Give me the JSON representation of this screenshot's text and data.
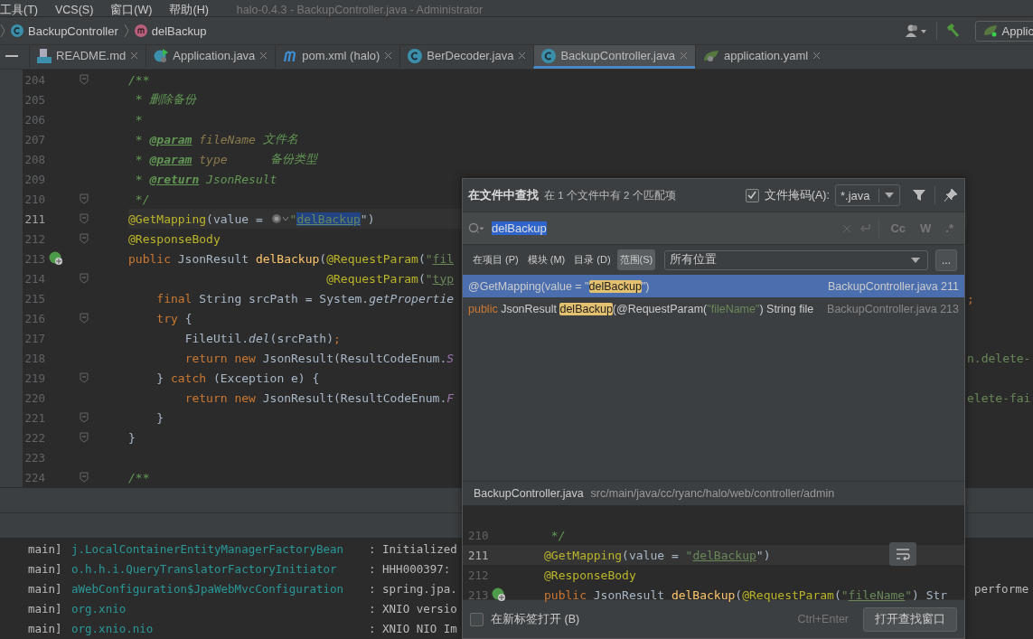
{
  "menu": [
    {
      "label": "工具(T)"
    },
    {
      "label": "VCS(S)"
    },
    {
      "label": "窗口(W)"
    },
    {
      "label": "帮助(H)"
    }
  ],
  "window": {
    "title": "halo-0.4.3 - BackupController.java - Administrator"
  },
  "breadcrumbs": [
    {
      "label": "BackupController",
      "kind": "class"
    },
    {
      "label": "delBackup",
      "kind": "method"
    }
  ],
  "toolbar": {
    "run_config": "Applic"
  },
  "tabs": [
    {
      "label": "README.md",
      "kind": "markdown",
      "selected": false
    },
    {
      "label": "Application.java",
      "kind": "runnable",
      "selected": false
    },
    {
      "label": "pom.xml (halo)",
      "kind": "maven",
      "selected": false
    },
    {
      "label": "BerDecoder.java",
      "kind": "class",
      "selected": false
    },
    {
      "label": "BackupController.java",
      "kind": "class",
      "selected": true
    },
    {
      "label": "application.yaml",
      "kind": "spring",
      "selected": false
    }
  ],
  "editor": {
    "lines": [
      {
        "number": "204",
        "kind": "code",
        "current": false,
        "fold": true,
        "segments": [
          {
            "text": "/**",
            "kind": "comment"
          }
        ]
      },
      {
        "number": "205",
        "kind": "code",
        "current": false,
        "fold": false,
        "segments": [
          {
            "text": " * 删除备份",
            "kind": "comment"
          }
        ]
      },
      {
        "number": "206",
        "kind": "code",
        "current": false,
        "fold": false,
        "segments": [
          {
            "text": " *",
            "kind": "comment"
          }
        ]
      },
      {
        "number": "207",
        "kind": "code",
        "current": false,
        "fold": false,
        "segments": [
          {
            "text": " * ",
            "kind": "comment"
          },
          {
            "text": "@param",
            "kind": "doc_tag"
          },
          {
            "text": " fileName",
            "kind": "doc_param"
          },
          {
            "text": " 文件名",
            "kind": "comment"
          }
        ]
      },
      {
        "number": "208",
        "kind": "code",
        "current": false,
        "fold": false,
        "segments": [
          {
            "text": " * ",
            "kind": "comment"
          },
          {
            "text": "@param",
            "kind": "doc_tag"
          },
          {
            "text": " type",
            "kind": "doc_param"
          },
          {
            "text": "      备份类型",
            "kind": "comment"
          }
        ]
      },
      {
        "number": "209",
        "kind": "code",
        "current": false,
        "fold": false,
        "segments": [
          {
            "text": " * ",
            "kind": "comment"
          },
          {
            "text": "@return",
            "kind": "doc_tag"
          },
          {
            "text": " JsonResult",
            "kind": "comment"
          }
        ]
      },
      {
        "number": "210",
        "kind": "code",
        "current": false,
        "fold": true,
        "segments": [
          {
            "text": " */",
            "kind": "comment"
          }
        ]
      },
      {
        "number": "211",
        "kind": "code",
        "current": true,
        "fold": true,
        "segments": [
          {
            "text": "@GetMapping",
            "kind": "annotation"
          },
          {
            "text": "(value = ",
            "kind": "plain"
          },
          {
            "kind": "inlay"
          },
          {
            "text": "\"",
            "kind": "string"
          },
          {
            "text": "delBackup",
            "kind": "selected_string"
          },
          {
            "text": "\")",
            "kind": "plain"
          }
        ]
      },
      {
        "number": "212",
        "kind": "code",
        "current": false,
        "fold": true,
        "segments": [
          {
            "text": "@ResponseBody",
            "kind": "annotation"
          }
        ]
      },
      {
        "number": "213",
        "kind": "endpoint",
        "current": false,
        "fold": false,
        "segments": [
          {
            "text": "public",
            "kind": "keyword"
          },
          {
            "text": " JsonResult ",
            "kind": "plain"
          },
          {
            "text": "delBackup",
            "kind": "method"
          },
          {
            "text": "(",
            "kind": "plain"
          },
          {
            "text": "@RequestParam",
            "kind": "annotation"
          },
          {
            "text": "(",
            "kind": "plain"
          },
          {
            "text": "\"",
            "kind": "string"
          },
          {
            "text": "fil",
            "kind": "string_ref"
          }
        ]
      },
      {
        "number": "214",
        "kind": "code",
        "current": false,
        "fold": true,
        "segments": [
          {
            "text": "                            @RequestParam",
            "kind": "annotation"
          },
          {
            "text": "(",
            "kind": "plain"
          },
          {
            "text": "\"",
            "kind": "string"
          },
          {
            "text": "typ",
            "kind": "string_ref"
          }
        ]
      },
      {
        "number": "215",
        "kind": "code",
        "current": false,
        "fold": false,
        "segments": [
          {
            "text": "    final",
            "kind": "keyword"
          },
          {
            "text": " String srcPath = System.",
            "kind": "plain"
          },
          {
            "text": "getPropertie",
            "kind": "static"
          }
        ],
        "right": [
          {
            "text": ";",
            "kind": "keyword"
          }
        ]
      },
      {
        "number": "216",
        "kind": "code",
        "current": false,
        "fold": true,
        "segments": [
          {
            "text": "    try",
            "kind": "keyword"
          },
          {
            "text": " {",
            "kind": "plain"
          }
        ]
      },
      {
        "number": "217",
        "kind": "code",
        "current": false,
        "fold": false,
        "segments": [
          {
            "text": "        FileUtil.",
            "kind": "plain"
          },
          {
            "text": "del",
            "kind": "static"
          },
          {
            "text": "(srcPath)",
            "kind": "plain"
          },
          {
            "text": ";",
            "kind": "keyword"
          }
        ]
      },
      {
        "number": "218",
        "kind": "code",
        "current": false,
        "fold": false,
        "segments": [
          {
            "text": "        return new",
            "kind": "keyword"
          },
          {
            "text": " JsonResult(ResultCodeEnum.",
            "kind": "plain"
          },
          {
            "text": "S",
            "kind": "constant"
          }
        ],
        "right": [
          {
            "text": "n.delete-",
            "kind": "string"
          }
        ]
      },
      {
        "number": "219",
        "kind": "code",
        "current": false,
        "fold": true,
        "segments": [
          {
            "text": "    } ",
            "kind": "plain"
          },
          {
            "text": "catch",
            "kind": "keyword"
          },
          {
            "text": " (Exception e) {",
            "kind": "plain"
          }
        ]
      },
      {
        "number": "220",
        "kind": "code",
        "current": false,
        "fold": false,
        "segments": [
          {
            "text": "        return new",
            "kind": "keyword"
          },
          {
            "text": " JsonResult(ResultCodeEnum.",
            "kind": "plain"
          },
          {
            "text": "F",
            "kind": "constant"
          }
        ],
        "right": [
          {
            "text": "elete-fai",
            "kind": "string"
          }
        ]
      },
      {
        "number": "221",
        "kind": "code",
        "current": false,
        "fold": true,
        "segments": [
          {
            "text": "    }",
            "kind": "plain"
          }
        ]
      },
      {
        "number": "222",
        "kind": "code",
        "current": false,
        "fold": true,
        "segments": [
          {
            "text": "}",
            "kind": "plain"
          }
        ]
      },
      {
        "number": "223",
        "kind": "code",
        "current": false,
        "fold": false
      },
      {
        "number": "224",
        "kind": "code",
        "current": false,
        "fold": true,
        "segments": [
          {
            "text": "/**",
            "kind": "comment"
          }
        ]
      }
    ]
  },
  "find_popup": {
    "title": "在文件中查找",
    "summary": "在 1 个文件中有 2 个匹配项",
    "file_mask": {
      "checked": true,
      "label": "文件掩码(A):",
      "value": "*.java"
    },
    "search": {
      "value": "delBackup"
    },
    "options": [
      "Cc",
      "W",
      ".*"
    ],
    "scopes": [
      {
        "label": "在项目 (P)",
        "selected": false
      },
      {
        "label": "模块 (M)",
        "selected": false
      },
      {
        "label": "目录 (D)",
        "selected": false
      },
      {
        "label": "范围(S)",
        "selected": true
      }
    ],
    "scope_value": "所有位置",
    "more_button": "...",
    "results": [
      {
        "selected": true,
        "segments": [
          {
            "text": "@GetMapping(value = \"",
            "kind": "plain"
          },
          {
            "text": "delBackup",
            "kind": "match"
          },
          {
            "text": "\")",
            "kind": "plain"
          }
        ],
        "file": "BackupController.java 211"
      },
      {
        "selected": false,
        "segments": [
          {
            "text": "public",
            "kind": "keyword"
          },
          {
            "text": " JsonResult ",
            "kind": "plain"
          },
          {
            "text": "delBackup",
            "kind": "match"
          },
          {
            "text": "(@RequestParam(",
            "kind": "plain"
          },
          {
            "text": "\"fileName\"",
            "kind": "string"
          },
          {
            "text": ") String file",
            "kind": "plain"
          }
        ],
        "file": "BackupController.java 213"
      }
    ],
    "preview_file": "BackupController.java",
    "preview_path": "src/main/java/cc/ryanc/halo/web/controller/admin",
    "preview_lines": [
      {
        "number": "210",
        "kind": "code",
        "current": false,
        "segments": [
          {
            "text": " */",
            "kind": "comment"
          }
        ]
      },
      {
        "number": "211",
        "kind": "code",
        "current": true,
        "segments": [
          {
            "text": "@GetMapping",
            "kind": "annotation"
          },
          {
            "text": "(value = ",
            "kind": "plain"
          },
          {
            "text": "\"",
            "kind": "string"
          },
          {
            "text": "delBackup",
            "kind": "string_ref"
          },
          {
            "text": "\")",
            "kind": "plain"
          }
        ]
      },
      {
        "number": "212",
        "kind": "code",
        "current": false,
        "segments": [
          {
            "text": "@ResponseBody",
            "kind": "annotation"
          }
        ]
      },
      {
        "number": "213",
        "kind": "endpoint",
        "current": false,
        "segments": [
          {
            "text": "public",
            "kind": "keyword"
          },
          {
            "text": " JsonResult ",
            "kind": "plain"
          },
          {
            "text": "delBackup",
            "kind": "method"
          },
          {
            "text": "(",
            "kind": "plain"
          },
          {
            "text": "@RequestParam",
            "kind": "annotation"
          },
          {
            "text": "(",
            "kind": "plain"
          },
          {
            "text": "\"",
            "kind": "string"
          },
          {
            "text": "fileName",
            "kind": "string_ref"
          },
          {
            "text": "\"",
            "kind": "string"
          },
          {
            "text": ") Str",
            "kind": "plain"
          }
        ]
      }
    ],
    "new_tab": {
      "checked": false,
      "label": "在新标签打开 (B)"
    },
    "shortcut": "Ctrl+Enter",
    "open_button": "打开查找窗口"
  },
  "console": {
    "rows": [
      {
        "thread": "main]",
        "logger": "j.LocalContainerEntityManagerFactoryBean",
        "message": ": Initialized"
      },
      {
        "thread": "main]",
        "logger": "o.h.h.i.QueryTranslatorFactoryInitiator",
        "message": ": HHH000397:"
      },
      {
        "thread": "main]",
        "logger": "aWebConfiguration$JpaWebMvcConfiguration",
        "message": ": spring.jpa.",
        "right": "performe"
      },
      {
        "thread": "main]",
        "logger": "org.xnio",
        "message": ": XNIO versio"
      },
      {
        "thread": "main]",
        "logger": "org.xnio.nio",
        "message": ": XNIO NIO Im"
      }
    ]
  }
}
